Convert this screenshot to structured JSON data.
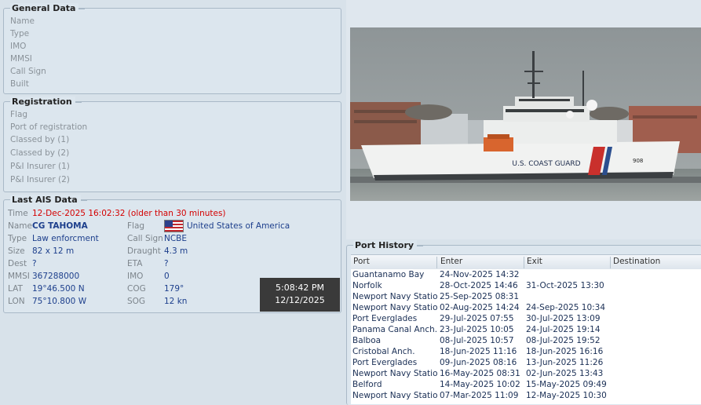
{
  "general": {
    "title": "General Data",
    "fields": [
      "Name",
      "Type",
      "IMO",
      "MMSI",
      "Call Sign",
      "Built"
    ]
  },
  "registration": {
    "title": "Registration",
    "fields": [
      "Flag",
      "Port of registration",
      "Classed by (1)",
      "Classed by (2)",
      "P&I Insurer (1)",
      "P&I Insurer (2)"
    ]
  },
  "ais": {
    "title": "Last AIS Data",
    "time_label": "Time",
    "time_value": "12-Dec-2025 16:02:32 (older than 30 minutes)",
    "name_label": "Name",
    "name_value": "CG TAHOMA",
    "type_label": "Type",
    "type_value": "Law enforcment",
    "size_label": "Size",
    "size_value": "82 x 12 m",
    "dest_label": "Dest",
    "dest_value": "?",
    "mmsi_label": "MMSI",
    "mmsi_value": "367288000",
    "lat_label": "LAT",
    "lat_value": "19°46.500 N",
    "lon_label": "LON",
    "lon_value": "75°10.800 W",
    "flag_label": "Flag",
    "flag_value": "United States of America",
    "callsign_label": "Call Sign",
    "callsign_value": "NCBE",
    "draught_label": "Draught",
    "draught_value": "4.3 m",
    "eta_label": "ETA",
    "eta_value": "?",
    "imo_label": "IMO",
    "imo_value": "0",
    "cog_label": "COG",
    "cog_value": "179°",
    "sog_label": "SOG",
    "sog_value": "12 kn"
  },
  "clock": {
    "time": "5:08:42 PM",
    "date": "12/12/2025"
  },
  "photo": {
    "hull_text": "U.S. COAST GUARD",
    "hull_number": "908"
  },
  "port_history": {
    "title": "Port History",
    "columns": [
      "Port",
      "Enter",
      "Exit",
      "Destination"
    ],
    "rows": [
      [
        "Guantanamo Bay",
        "24-Nov-2025 14:32",
        "",
        ""
      ],
      [
        "Norfolk",
        "28-Oct-2025 14:46",
        "31-Oct-2025 13:30",
        ""
      ],
      [
        "Newport Navy Station",
        "25-Sep-2025 08:31",
        "",
        ""
      ],
      [
        "Newport Navy Station",
        "02-Aug-2025 14:24",
        "24-Sep-2025 10:34",
        ""
      ],
      [
        "Port Everglades",
        "29-Jul-2025 07:55",
        "30-Jul-2025 13:09",
        ""
      ],
      [
        "Panama Canal Anch...",
        "23-Jul-2025 10:05",
        "24-Jul-2025 19:14",
        ""
      ],
      [
        "Balboa",
        "08-Jul-2025 10:57",
        "08-Jul-2025 19:52",
        ""
      ],
      [
        "Cristobal Anch.",
        "18-Jun-2025 11:16",
        "18-Jun-2025 16:16",
        ""
      ],
      [
        "Port Everglades",
        "09-Jun-2025 08:16",
        "13-Jun-2025 11:26",
        ""
      ],
      [
        "Newport Navy Station",
        "16-May-2025 08:31",
        "02-Jun-2025 13:43",
        ""
      ],
      [
        "Belford",
        "14-May-2025 10:02",
        "15-May-2025 09:49",
        ""
      ],
      [
        "Newport Navy Station",
        "07-Mar-2025 11:09",
        "12-May-2025 10:30",
        ""
      ]
    ]
  }
}
